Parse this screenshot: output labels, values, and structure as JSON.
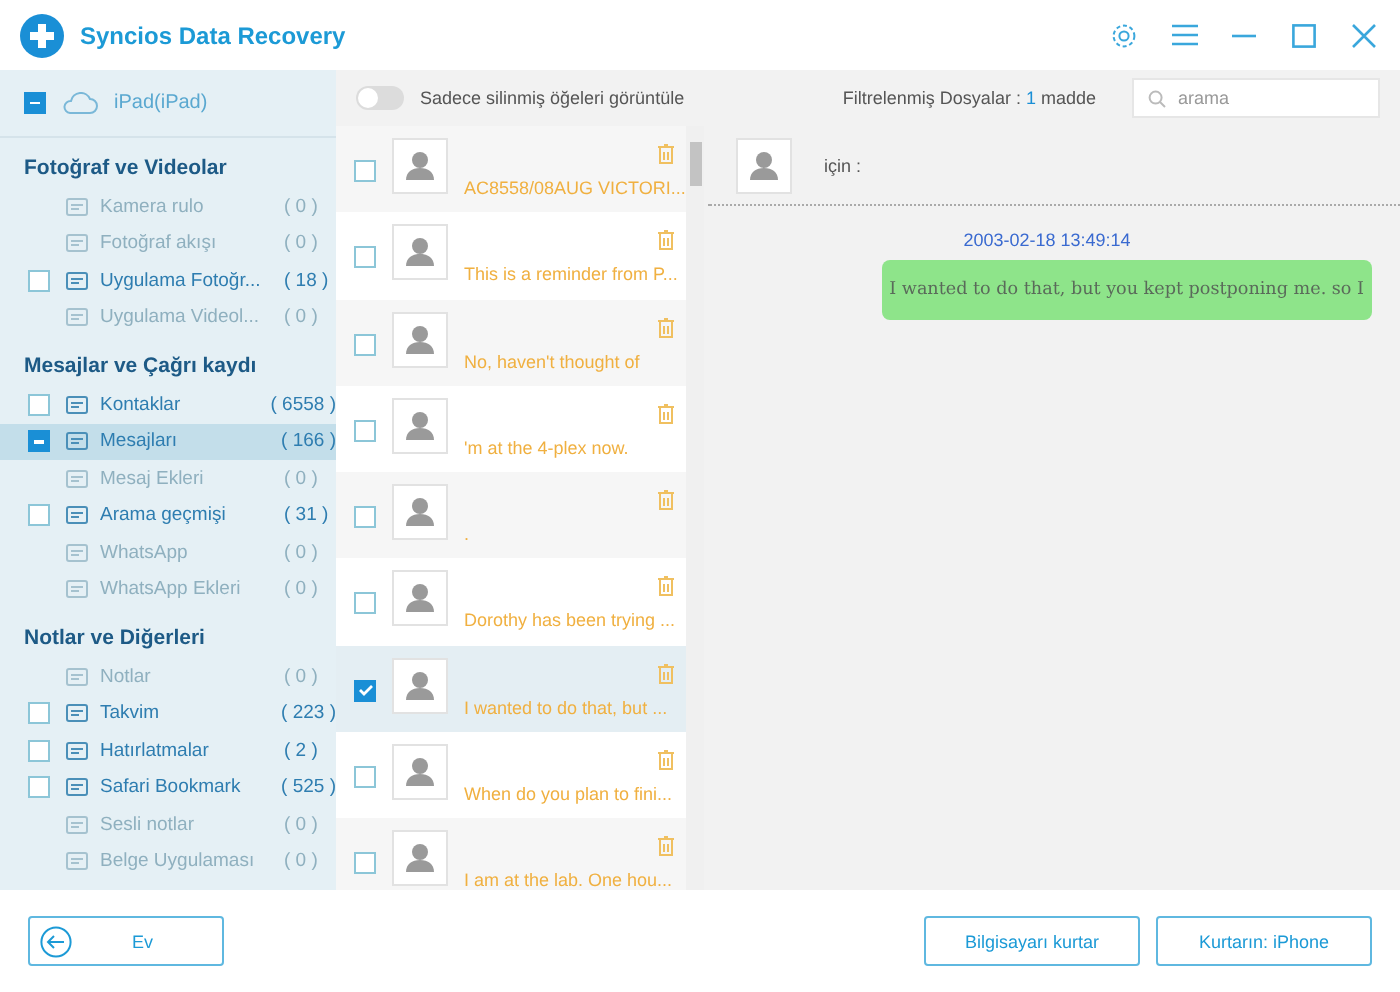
{
  "window": {
    "title": "Syncios Data Recovery"
  },
  "sidebar": {
    "device": {
      "label": "iPad(iPad)",
      "checked": true
    },
    "sections": [
      {
        "title": "Fotoğraf ve Videolar",
        "items": [
          {
            "label": "Kamera rulo",
            "count": "( 0 )",
            "disabled": true,
            "checked": false,
            "selected": false
          },
          {
            "label": "Fotoğraf akışı",
            "count": "( 0 )",
            "disabled": true,
            "checked": false,
            "selected": false
          },
          {
            "label": "Uygulama Fotoğr...",
            "count": "( 18 )",
            "disabled": false,
            "checked": false,
            "selected": false
          },
          {
            "label": "Uygulama Videol...",
            "count": "( 0 )",
            "disabled": true,
            "checked": false,
            "selected": false
          }
        ]
      },
      {
        "title": "Mesajlar ve Çağrı kaydı",
        "items": [
          {
            "label": "Kontaklar",
            "count": "( 6558 )",
            "disabled": false,
            "checked": false,
            "selected": false
          },
          {
            "label": "Mesajları",
            "count": "( 166 )",
            "disabled": false,
            "checked": true,
            "selected": true
          },
          {
            "label": "Mesaj Ekleri",
            "count": "( 0 )",
            "disabled": true,
            "checked": false,
            "selected": false
          },
          {
            "label": "Arama geçmişi",
            "count": "( 31 )",
            "disabled": false,
            "checked": false,
            "selected": false
          },
          {
            "label": "WhatsApp",
            "count": "( 0 )",
            "disabled": true,
            "checked": false,
            "selected": false
          },
          {
            "label": "WhatsApp Ekleri",
            "count": "( 0 )",
            "disabled": true,
            "checked": false,
            "selected": false
          }
        ]
      },
      {
        "title": "Notlar ve Diğerleri",
        "items": [
          {
            "label": "Notlar",
            "count": "( 0 )",
            "disabled": true,
            "checked": false,
            "selected": false
          },
          {
            "label": "Takvim",
            "count": "( 223 )",
            "disabled": false,
            "checked": false,
            "selected": false
          },
          {
            "label": "Hatırlatmalar",
            "count": "( 2 )",
            "disabled": false,
            "checked": false,
            "selected": false
          },
          {
            "label": "Safari Bookmark",
            "count": "( 525 )",
            "disabled": false,
            "checked": false,
            "selected": false
          },
          {
            "label": "Sesli notlar",
            "count": "( 0 )",
            "disabled": true,
            "checked": false,
            "selected": false
          },
          {
            "label": "Belge Uygulaması",
            "count": "( 0 )",
            "disabled": true,
            "checked": false,
            "selected": false
          }
        ]
      }
    ]
  },
  "toolbar": {
    "deleted_only_toggle": {
      "label": "Sadece silinmiş öğeleri görüntüle",
      "on": false
    },
    "filter": {
      "label": "Filtrelenmiş Dosyalar :",
      "count": "1",
      "unit": "madde"
    },
    "search": {
      "placeholder": "arama"
    }
  },
  "messages": [
    {
      "preview": "AC8558/08AUG VICTORI...",
      "checked": false,
      "selected": false
    },
    {
      "preview": "This is a reminder from P...",
      "checked": false,
      "selected": false
    },
    {
      "preview": "No, haven't thought of",
      "checked": false,
      "selected": false
    },
    {
      "preview": "'m at the 4-plex now.",
      "checked": false,
      "selected": false
    },
    {
      "preview": ".",
      "checked": false,
      "selected": false
    },
    {
      "preview": "Dorothy has been trying ...",
      "checked": false,
      "selected": false
    },
    {
      "preview": "I wanted to do that, but ...",
      "checked": true,
      "selected": true
    },
    {
      "preview": "When do you plan to fini...",
      "checked": false,
      "selected": false
    },
    {
      "preview": "I am at the lab. One hou...",
      "checked": false,
      "selected": false
    }
  ],
  "conversation": {
    "recipient_label": "için :",
    "timestamp": "2003-02-18 13:49:14",
    "bubble": "I wanted to do that, but you kept postponing me. so I"
  },
  "footer": {
    "buttons": [
      {
        "label": "Ev",
        "kind": "back"
      },
      {
        "label": "Bilgisayarı kurtar",
        "kind": "plain"
      },
      {
        "label": "Kurtarın: iPhone",
        "kind": "plain"
      }
    ]
  }
}
